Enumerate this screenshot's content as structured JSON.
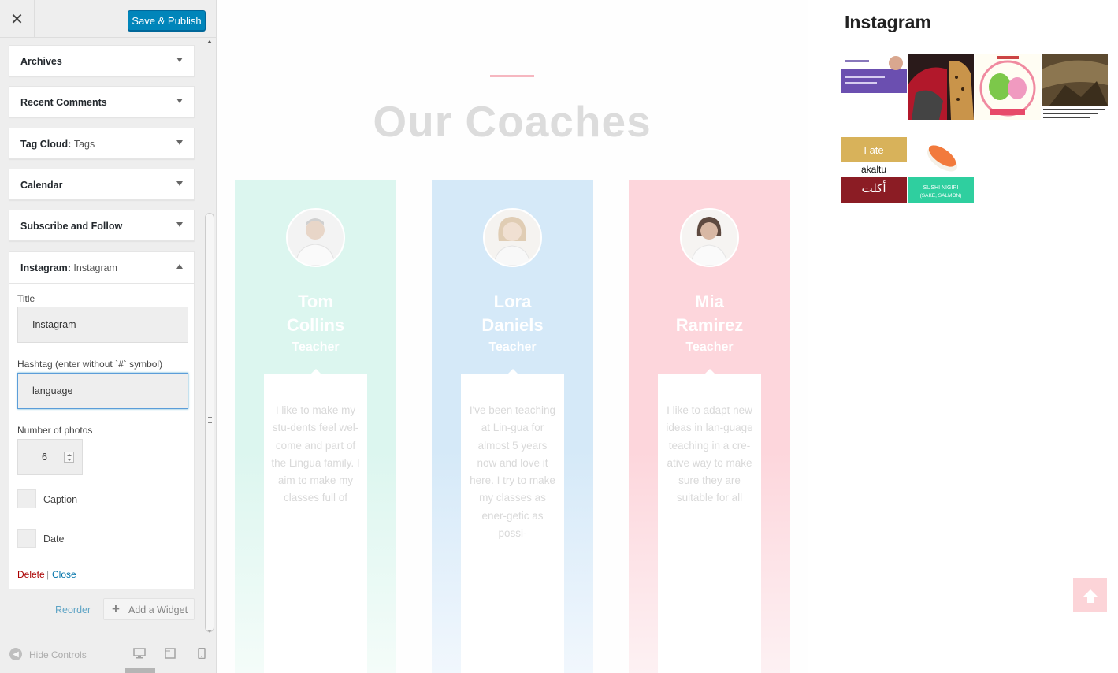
{
  "customizer": {
    "close_label": "✕",
    "publish_label": "Save & Publish",
    "widgets": [
      {
        "title": "Archives",
        "subtitle": ""
      },
      {
        "title": "Recent Comments",
        "subtitle": ""
      },
      {
        "title": "Tag Cloud:",
        "subtitle": "Tags"
      },
      {
        "title": "Calendar",
        "subtitle": ""
      },
      {
        "title": "Subscribe and Follow",
        "subtitle": ""
      }
    ],
    "instagram_widget": {
      "title": "Instagram:",
      "subtitle": "Instagram",
      "title_label": "Title",
      "title_value": "Instagram",
      "hashtag_label": "Hashtag (enter without `#` symbol)",
      "hashtag_value": "language",
      "photos_label": "Number of photos",
      "photos_value": "6",
      "caption_label": "Caption",
      "date_label": "Date",
      "delete_label": "Delete",
      "separator": "|",
      "close_label": "Close"
    },
    "reorder_label": "Reorder",
    "add_widget_plus": "+",
    "add_widget_label": "Add a Widget",
    "hide_controls_label": "Hide Controls"
  },
  "preview": {
    "section_title": "Our Coaches",
    "coaches": [
      {
        "name_line1": "Tom",
        "name_line2": "Collins",
        "role": "Teacher",
        "bio": "I like to make my stu-dents feel wel-come and part of the Lingua family. I aim to make my classes full of"
      },
      {
        "name_line1": "Lora",
        "name_line2": "Daniels",
        "role": "Teacher",
        "bio": "I've been teaching at Lin-gua for almost 5 years now and love it here. I try to make my classes as ener-getic as possi-"
      },
      {
        "name_line1": "Mia",
        "name_line2": "Ramirez",
        "role": "Teacher",
        "bio": "I like to adapt new ideas in lan-guage teaching in a cre-ative way to make sure they are suitable for all"
      }
    ],
    "instagram": {
      "title": "Instagram",
      "photo5_text1": "I ate",
      "photo5_text2": "akaltu",
      "photo5_text3": "أكلت",
      "photo6_text1": "SUSHI NIGIRI",
      "photo6_text2": "(SAKE, SALMON)"
    }
  },
  "colors": {
    "publish_button": "#0085ba",
    "link": "#0073aa",
    "delete": "#aa0000",
    "coach_green": "#dcf6ef",
    "coach_blue": "#d5e9f8",
    "coach_pink": "#fdd6dc"
  }
}
